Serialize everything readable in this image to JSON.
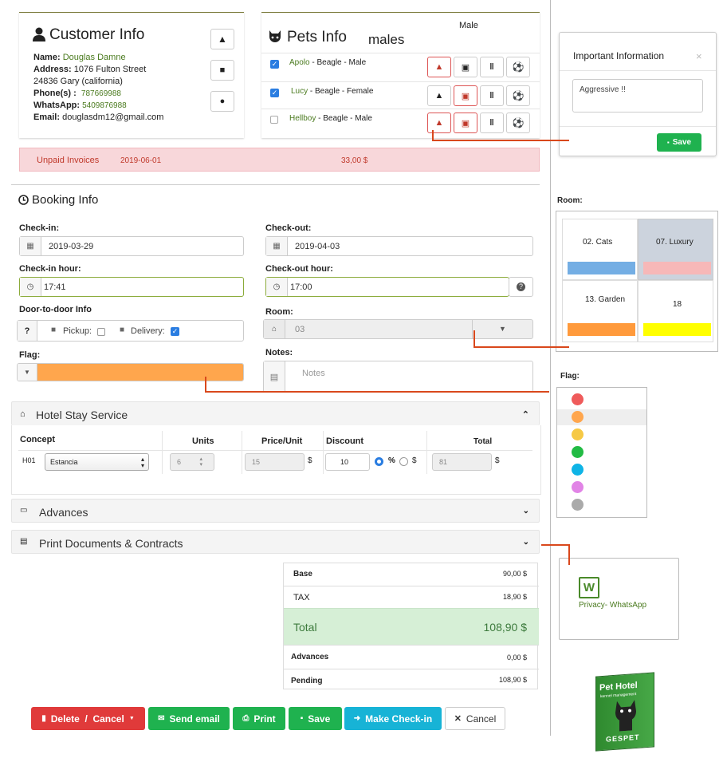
{
  "customer": {
    "title": "Customer Info",
    "name_label": "Name:",
    "name": "Douglas Damne",
    "address_label": "Address:",
    "address1": "1076 Fulton Street",
    "address2": "24836 Gary (california)",
    "phone_label": "Phone(s) :",
    "phone": "787669988",
    "whatsapp_label": "WhatsApp:",
    "whatsapp": "5409876988",
    "email_label": "Email:",
    "email": "douglasdm12@gmail.com"
  },
  "pets": {
    "title": "Pets Info",
    "overlap_text": "males",
    "header_right": "Male",
    "rows": [
      {
        "name": "Apolo",
        "desc": " - Beagle - Male",
        "checked": true
      },
      {
        "name": "Lucy",
        "desc": " - Beagle - Female",
        "checked": true
      },
      {
        "name": "Hellboy",
        "desc": " - Beagle - Male",
        "checked": false
      }
    ]
  },
  "invoices": {
    "label": "Unpaid Invoices",
    "date": "2019-06-01",
    "amount": "33,00 $"
  },
  "important_popup": {
    "title": "Important Information",
    "close": "×",
    "note": "Aggressive !!",
    "save": "Save"
  },
  "booking": {
    "title": "Booking Info",
    "checkin_label": "Check-in:",
    "checkin": "2019-03-29",
    "checkout_label": "Check-out:",
    "checkout": "2019-04-03",
    "checkin_hour_label": "Check-in hour:",
    "checkin_hour": "17:41",
    "checkout_hour_label": "Check-out hour:",
    "checkout_hour": "17:00",
    "door_label": "Door-to-door Info",
    "door_q": "?",
    "pickup": "Pickup:",
    "delivery": "Delivery:",
    "room_label": "Room:",
    "room": "03",
    "flag_label": "Flag:",
    "notes_label": "Notes:",
    "notes_placeholder": "Notes"
  },
  "room_popup": {
    "label": "Room:",
    "rooms": [
      {
        "name": "02. Cats",
        "color": "#74aee4"
      },
      {
        "name": "07. Luxury",
        "color": "#f7b8b8"
      },
      {
        "name": "13. Garden",
        "color": "#ff9a3c"
      },
      {
        "name": "18",
        "color": "#ffff00"
      }
    ]
  },
  "flag_popup": {
    "label": "Flag:",
    "colors": [
      "#ef5b5b",
      "#ffa64d",
      "#f6c945",
      "#22bb44",
      "#0fb4e6",
      "#e184e6",
      "#aaaaaa"
    ]
  },
  "hotel_stay": {
    "title": "Hotel Stay Service",
    "col_concept": "Concept",
    "col_units": "Units",
    "col_price": "Price/Unit",
    "col_discount": "Discount",
    "col_total": "Total",
    "code": "H01",
    "concept": "Estancia",
    "units": "6",
    "price": "15",
    "currency": "$",
    "discount": "10",
    "pct": "%",
    "dollar": "$",
    "total": "81"
  },
  "advances_title": "Advances",
  "print_title": "Print Documents & Contracts",
  "doc_popup": {
    "label": "Privacy- WhatsApp",
    "glyph": "W"
  },
  "totals": {
    "base_label": "Base",
    "base": "90,00 $",
    "tax_label": "TAX",
    "tax": "18,90 $",
    "total_label": "Total",
    "total": "108,90 $",
    "advances_label": "Advances",
    "advances": "0,00 $",
    "pending_label": "Pending",
    "pending": "108,90 $"
  },
  "actions": {
    "delete": "Delete  /  Cancel",
    "send_email": "Send email",
    "print": "Print",
    "save": "Save",
    "checkin": "Make Check-in",
    "cancel": "Cancel"
  },
  "product_box": {
    "title": "Pet Hotel",
    "sub": "kennel management",
    "brand": "GESPET"
  }
}
